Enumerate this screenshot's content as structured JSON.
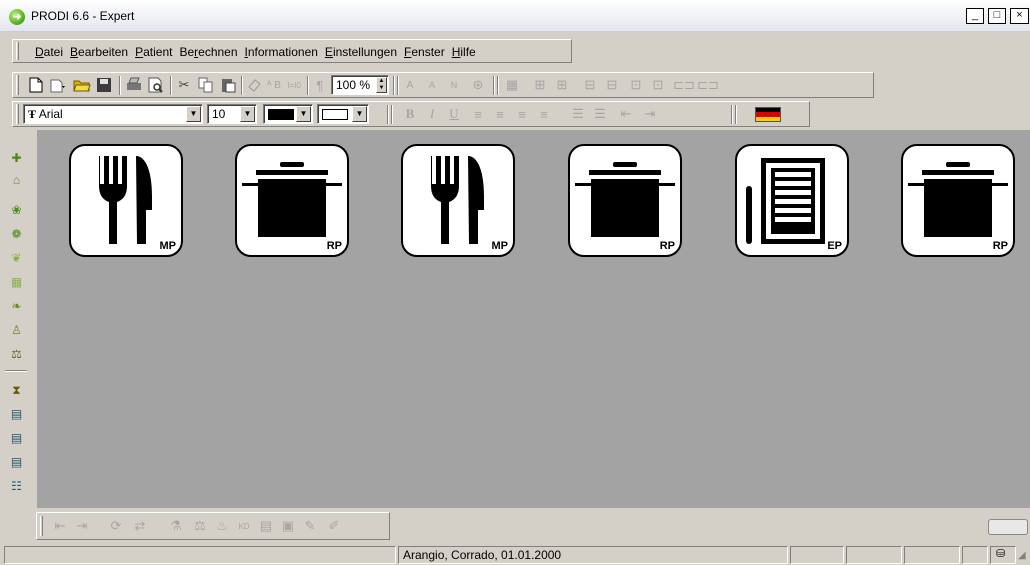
{
  "window": {
    "title": "PRODI 6.6 - Expert",
    "minimize": "_",
    "maximize": "□",
    "close": "×"
  },
  "menu": [
    {
      "hot": "D",
      "rest": "atei"
    },
    {
      "hot": "B",
      "rest": "earbeiten"
    },
    {
      "hot": "P",
      "rest": "atient"
    },
    {
      "pre": "Be",
      "hot": "r",
      "rest": "echnen"
    },
    {
      "hot": "I",
      "rest": "nformationen"
    },
    {
      "hot": "E",
      "rest": "instellungen"
    },
    {
      "hot": "F",
      "rest": "enster"
    },
    {
      "hot": "H",
      "rest": "ilfe"
    }
  ],
  "toolbar": {
    "zoom": "100 %",
    "font_name": "Arial",
    "font_size": "10",
    "font_icon": "Ŧ"
  },
  "tiles": [
    {
      "icon": "cutlery",
      "code": "MP"
    },
    {
      "icon": "pot",
      "code": "RP"
    },
    {
      "icon": "cutlery",
      "code": "MP"
    },
    {
      "icon": "pot",
      "code": "RP"
    },
    {
      "icon": "document",
      "code": "EP"
    },
    {
      "icon": "pot",
      "code": "RP"
    }
  ],
  "status": {
    "patient": "Arangio, Corrado, 01.01.2000"
  },
  "colors": {
    "workspace": "#a3a3a3",
    "chrome": "#d4d0c8",
    "app_icon": "#4aa81a"
  }
}
